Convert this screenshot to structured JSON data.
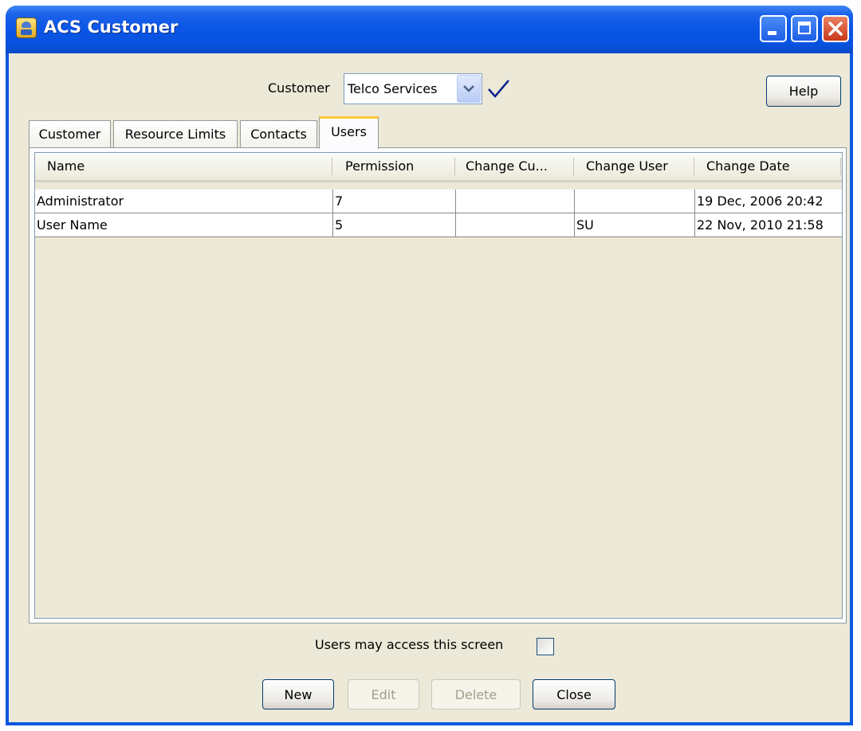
{
  "window": {
    "title": "ACS Customer"
  },
  "customer": {
    "label": "Customer",
    "selected": "Telco Services"
  },
  "help_label": "Help",
  "tabs": [
    {
      "label": "Customer"
    },
    {
      "label": "Resource Limits"
    },
    {
      "label": "Contacts"
    },
    {
      "label": "Users",
      "active": true
    }
  ],
  "table": {
    "columns": [
      "Name",
      "Permission",
      "Change Cu...",
      "Change User",
      "Change Date"
    ],
    "rows": [
      [
        "Administrator",
        "7",
        "",
        "",
        "19 Dec, 2006 20:42"
      ],
      [
        "User Name",
        "5",
        "",
        "SU",
        "22 Nov, 2010 21:58"
      ]
    ]
  },
  "access": {
    "label": "Users may access this screen",
    "checked": false
  },
  "buttons": {
    "new": "New",
    "edit": "Edit",
    "delete": "Delete",
    "close": "Close"
  },
  "colors": {
    "titlebar": "#0A55E6",
    "client": "#ECE9D8",
    "active_tab_accent": "#FFC83C"
  }
}
